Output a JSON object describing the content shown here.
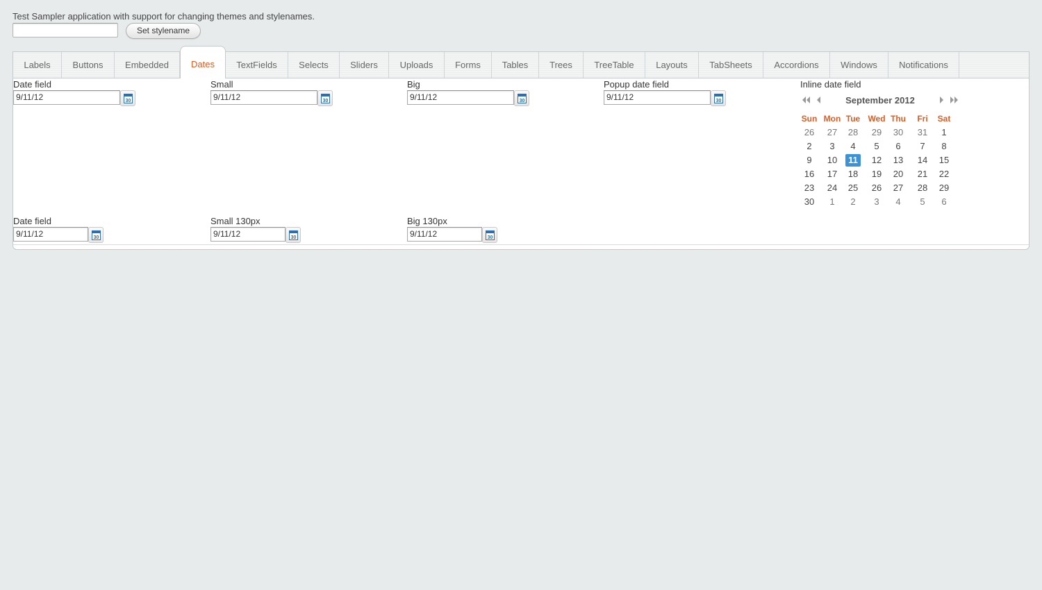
{
  "intro_text": "Test Sampler application with support for changing themes and stylenames.",
  "stylename": {
    "value": "",
    "button_label": "Set stylename"
  },
  "tabs": [
    "Labels",
    "Buttons",
    "Embedded",
    "Dates",
    "TextFields",
    "Selects",
    "Sliders",
    "Uploads",
    "Forms",
    "Tables",
    "Trees",
    "TreeTable",
    "Layouts",
    "TabSheets",
    "Accordions",
    "Windows",
    "Notifications"
  ],
  "active_tab": "Dates",
  "row1": [
    {
      "label": "Date field",
      "value": "9/11/12"
    },
    {
      "label": "Small",
      "value": "9/11/12"
    },
    {
      "label": "Big",
      "value": "9/11/12"
    },
    {
      "label": "Popup date field",
      "value": "9/11/12"
    }
  ],
  "row2": [
    {
      "label": "Date field",
      "value": "9/11/12"
    },
    {
      "label": "Small 130px",
      "value": "9/11/12"
    },
    {
      "label": "Big 130px",
      "value": "9/11/12"
    }
  ],
  "inline": {
    "label": "Inline date field",
    "month_title": "September 2012",
    "weekdays": [
      "Sun",
      "Mon",
      "Tue",
      "Wed",
      "Thu",
      "Fri",
      "Sat"
    ],
    "weeks": [
      [
        "26",
        "27",
        "28",
        "29",
        "30",
        "31",
        "1"
      ],
      [
        "2",
        "3",
        "4",
        "5",
        "6",
        "7",
        "8"
      ],
      [
        "9",
        "10",
        "11",
        "12",
        "13",
        "14",
        "15"
      ],
      [
        "16",
        "17",
        "18",
        "19",
        "20",
        "21",
        "22"
      ],
      [
        "23",
        "24",
        "25",
        "26",
        "27",
        "28",
        "29"
      ],
      [
        "30",
        "1",
        "2",
        "3",
        "4",
        "5",
        "6"
      ]
    ],
    "selected": "11"
  },
  "icons": {
    "calendar": "calendar-30-icon"
  },
  "colors": {
    "accent": "#e05a20",
    "selected": "#3b92d6"
  }
}
